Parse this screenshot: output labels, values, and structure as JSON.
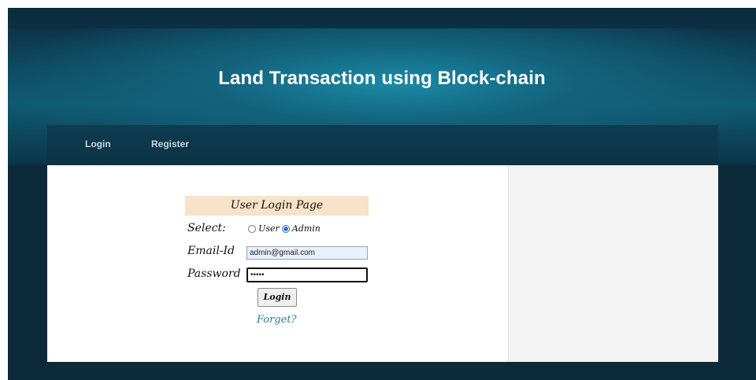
{
  "site": {
    "title": "Land Transaction using Block-chain"
  },
  "nav": {
    "items": [
      {
        "label": "Login"
      },
      {
        "label": "Register"
      }
    ]
  },
  "login_form": {
    "title": "User Login Page",
    "select_label": "Select:",
    "role_options": [
      {
        "label": "User",
        "selected": false
      },
      {
        "label": "Admin",
        "selected": true
      }
    ],
    "email_label": "Email-Id",
    "email_value": "admin@gmail.com",
    "password_label": "Password",
    "password_value": "•••••",
    "login_button": "Login",
    "forget_link": "Forget?"
  },
  "colors": {
    "header_dark": "#0c2a3a",
    "header_glow": "#1b8aa6",
    "form_title_bg": "#f7e3c8",
    "link": "#2d7c9e"
  }
}
